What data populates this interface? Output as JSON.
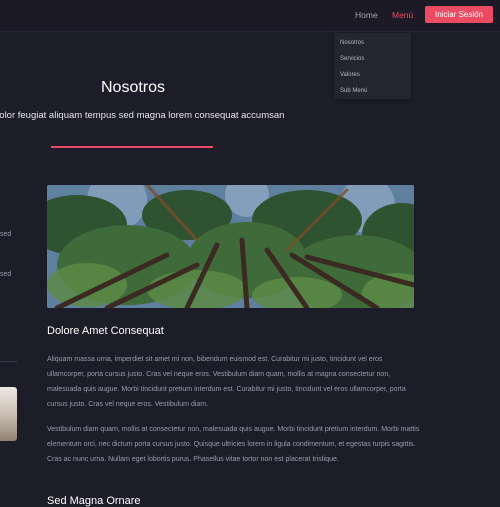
{
  "nav": {
    "home": "Home",
    "menu": "Menú",
    "login": "Iniciar Sesión",
    "dropdown": [
      "Nosotros",
      "Servicios",
      "Valores",
      "Sub Menú"
    ]
  },
  "hero": {
    "title": "Nosotros",
    "subtitle": "dolor feugiat aliquam tempus sed magna lorem consequat accumsan"
  },
  "sidebar_fragments": [
    "sed",
    "sed"
  ],
  "article": {
    "heading": "Dolore Amet Consequat",
    "paragraphs": [
      "Aliquam massa urna, imperdiet sit amet mi non, bibendum euismod est. Curabitur mi justo, tincidunt vel eros ullamcorper, porta cursus justo. Cras vel neque eros. Vestibulum diam quam, mollis at magna consectetur non, malesuada quis augue. Morbi tincidunt pretium interdum est. Curabitur mi justo, tincidunt vel eros ullamcorper, porta cursus justo. Cras vel neque eros. Vestibulum diam.",
      "Vestibulum diam quam, mollis at consectetur non, malesuada quis augue. Morbi tincidunt pretium interdum. Morbi mattis elementum orci, nec dictum porta cursus justo. Quisque ultricies lorem in ligula condimentum, et egestas turpis sagittis. Cras ac nunc urna. Nullam eget lobortis purus. Phasellus vitae tortor non est placerat tristique."
    ],
    "next_heading": "Sed Magna Ornare"
  },
  "colors": {
    "background": "#1d1c29",
    "accent": "#ec4b63",
    "dropdown_bg": "#252431"
  }
}
